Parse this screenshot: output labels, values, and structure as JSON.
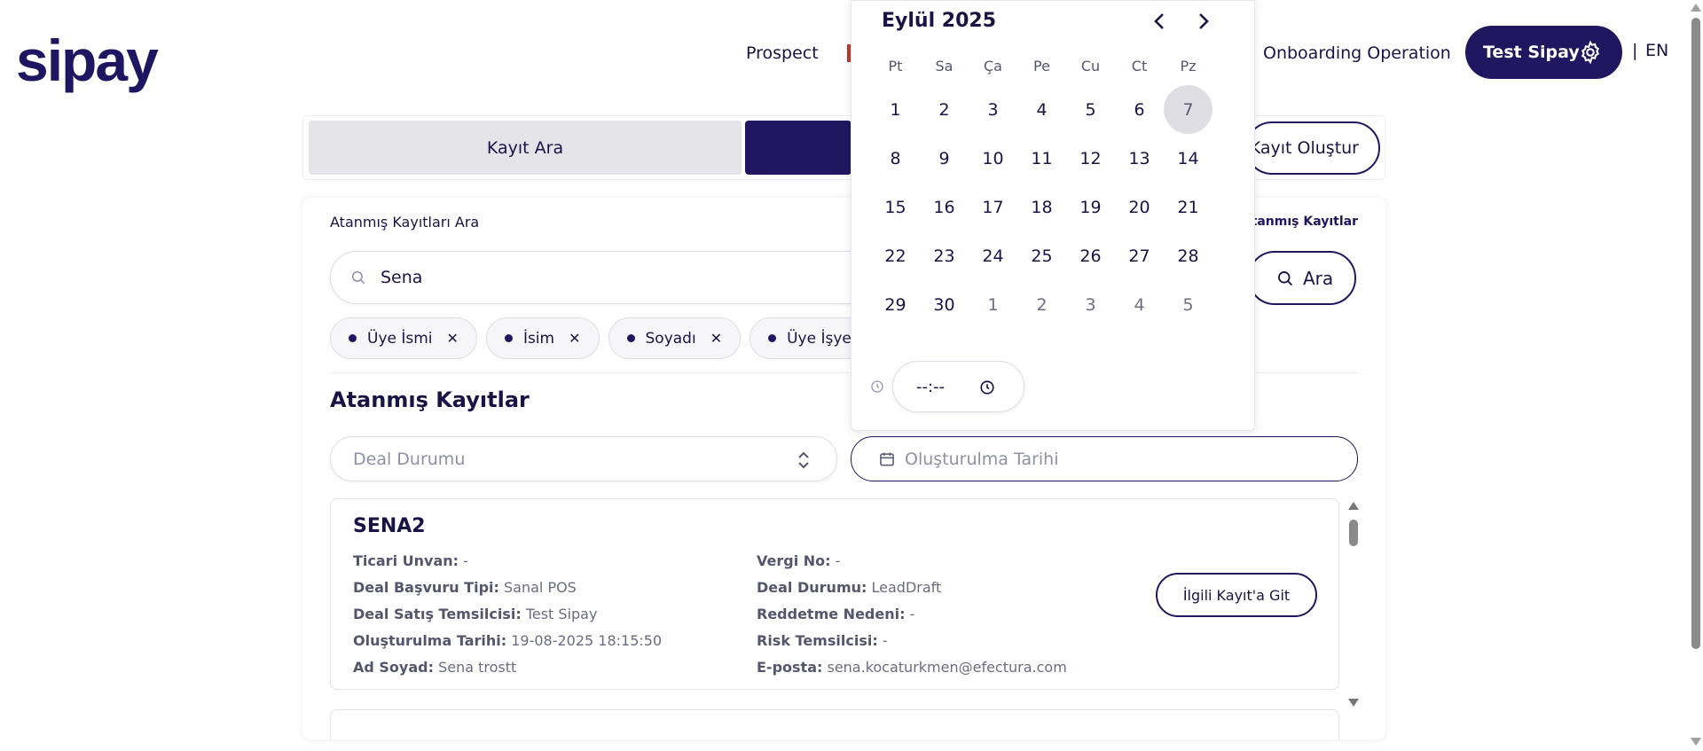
{
  "brand": {
    "logo_text": "sipay"
  },
  "nav": {
    "prospect": "Prospect",
    "onboarding_operation": "Onboarding Operation",
    "user_label": "Test Sipay",
    "lang_sep": "|",
    "lang": "EN"
  },
  "tabs": {
    "search_record": "Kayıt Ara",
    "create_record": "Kayıt Oluştur"
  },
  "search": {
    "label": "Atanmış Kayıtları Ara",
    "assigned_link": "Atanmış Kayıtlar",
    "value": "Sena",
    "button": "Ara",
    "chips": [
      "Üye İsmi",
      "İsim",
      "Soyadı",
      "Üye İşyeri To"
    ]
  },
  "assigned": {
    "title": "Atanmış Kayıtlar",
    "deal_status_placeholder": "Deal Durumu",
    "created_date_placeholder": "Oluşturulma Tarihi"
  },
  "record": {
    "name": "SENA2",
    "left": [
      {
        "label": "Ticari Unvan:",
        "value": "-"
      },
      {
        "label": "Deal Başvuru Tipi:",
        "value": "Sanal POS"
      },
      {
        "label": "Deal Satış Temsilcisi:",
        "value": "Test Sipay"
      },
      {
        "label": "Oluşturulma Tarihi:",
        "value": "19-08-2025 18:15:50"
      },
      {
        "label": "Ad Soyad:",
        "value": "Sena trostt"
      }
    ],
    "right": [
      {
        "label": "Vergi No:",
        "value": "-"
      },
      {
        "label": "Deal Durumu:",
        "value": "LeadDraft"
      },
      {
        "label": "Reddetme Nedeni:",
        "value": "-"
      },
      {
        "label": "Risk Temsilcisi:",
        "value": "-"
      },
      {
        "label": "E-posta:",
        "value": "sena.kocaturkmen@efectura.com"
      }
    ],
    "button": "İlgili Kayıt'a Git"
  },
  "calendar": {
    "title": "Eylül 2025",
    "weekdays": [
      "Pt",
      "Sa",
      "Ça",
      "Pe",
      "Cu",
      "Ct",
      "Pz"
    ],
    "weeks": [
      [
        "1",
        "2",
        "3",
        "4",
        "5",
        "6",
        "7"
      ],
      [
        "8",
        "9",
        "10",
        "11",
        "12",
        "13",
        "14"
      ],
      [
        "15",
        "16",
        "17",
        "18",
        "19",
        "20",
        "21"
      ],
      [
        "22",
        "23",
        "24",
        "25",
        "26",
        "27",
        "28"
      ],
      [
        "29",
        "30",
        "1",
        "2",
        "3",
        "4",
        "5"
      ]
    ],
    "highlighted_day": "7",
    "time_value": "--:--"
  },
  "colors": {
    "brand_dark": "#211760",
    "today_bg": "#dedee4",
    "accent_red": "#c0392b"
  }
}
